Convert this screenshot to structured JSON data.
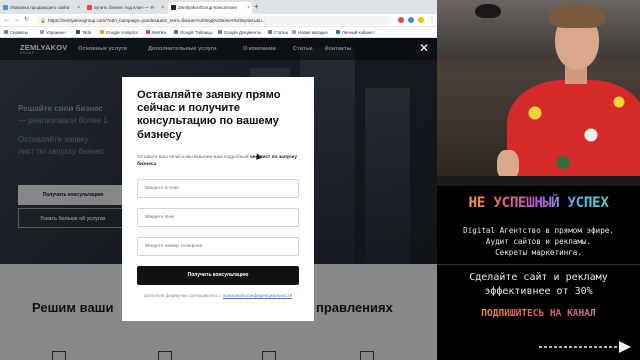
{
  "browser": {
    "tabs": [
      {
        "label": "Упаковка продающего сайта",
        "color": "#4a90d9"
      },
      {
        "label": "купить бизнес под ключ — Я",
        "color": "#e24a3b"
      },
      {
        "label": "ZemlyakovGroup Консалтинг",
        "color": "#222222"
      }
    ],
    "new_tab": "+",
    "url": "https://zemlyakovgroup.com/?utm_campaign=yandex&utm_term=бизнес%20под%20ключ%20купить&u...",
    "bookmarks": [
      {
        "label": "Сервисы",
        "color": "#4285f4"
      },
      {
        "label": "Упражнен",
        "color": "#9aa0a6"
      },
      {
        "label": "Tilda",
        "color": "#444444"
      },
      {
        "label": "Google Analytics",
        "color": "#f4a21e"
      },
      {
        "label": "Metrika",
        "color": "#e8453c"
      },
      {
        "label": "Google Таблицы",
        "color": "#0f9d58"
      },
      {
        "label": "Google Документы",
        "color": "#4285f4"
      },
      {
        "label": "Статьи",
        "color": "#777777"
      },
      {
        "label": "Новая вкладка",
        "color": "#9aa0a6"
      },
      {
        "label": "Личный кабинет",
        "color": "#1a73e8"
      }
    ]
  },
  "site": {
    "logo": "ZEMLYAKOV",
    "logo_sub": "GROUP",
    "nav": [
      "Основные услуги",
      "Дополнительные услуги",
      "О компании",
      "Статьи",
      "Контакты"
    ],
    "hero_lines": [
      "Решайте свои бизнес",
      "— реализовали более 1",
      "Оставляйте заявку",
      "лист по запуску бизнес"
    ],
    "buttons": {
      "primary": "Получить консультацию",
      "secondary": "Узнать больше об услугах"
    },
    "bottom_headline_left": "Решим ваши",
    "bottom_headline_right": "правлениях"
  },
  "modal": {
    "title": "Оставляйте заявку прямо сейчас и получите консультацию по вашему бизнесу",
    "sub_text": "Оставьте ваш email и мы вышлем вам подробный ",
    "sub_bold": "чек-лист по запуску бизнеса",
    "email_placeholder": "Введите E-mail",
    "name_placeholder": "Введите Имя",
    "phone_placeholder": "Введите номер телефона",
    "submit": "Получить консультацию",
    "note": "Заполняя форму вы соглашаетесь с ",
    "note_link": "политикой конфиденциальности"
  },
  "panel": {
    "banner": "НЕ УСПЕШНЫЙ УСПЕХ",
    "lines_1": [
      "Digital Агентство в прямом эфире.",
      "Аудит сайтов и рекламы.",
      "Секреты маркетинга."
    ],
    "lines_2": [
      "Сделайте сайт и рекламу",
      "эффективнее от 30%"
    ],
    "subscribe": "ПОДПИШИТЕСЬ НА КАНАЛ"
  }
}
